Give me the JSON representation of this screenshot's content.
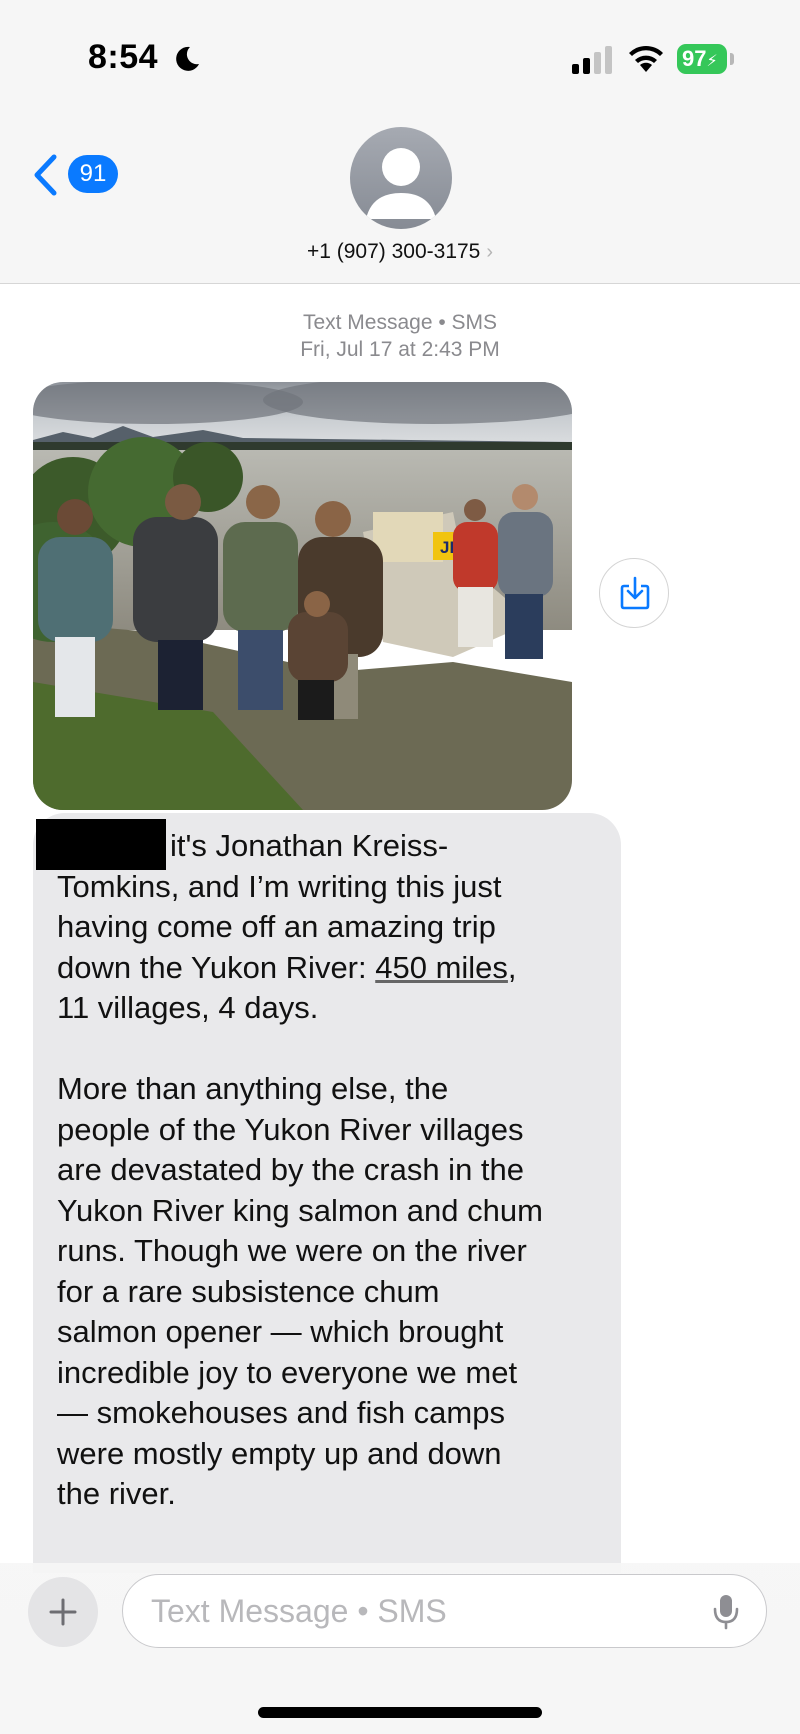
{
  "status_bar": {
    "time": "8:54",
    "battery": "97",
    "battery_color": "#35c759",
    "icons": [
      "moon-icon",
      "signal-icon",
      "wifi-icon",
      "battery-icon"
    ]
  },
  "header": {
    "back_badge": "91",
    "contact": "+1 (907) 300-3175",
    "contact_chevron": "›",
    "accent_color": "#0a7aff"
  },
  "conversation": {
    "service": "Text Message • SMS",
    "timestamp": "Fri, Jul 17 at 2:43 PM"
  },
  "message": {
    "line1_suffix": "it's Jonathan Kreiss-",
    "line2": "Tomkins, and I’m writing this just",
    "line3": "having come off an amazing trip",
    "line4_prefix": "down the Yukon River: ",
    "link": "450 miles",
    "line4_suffix": ",",
    "line5": "11 villages, 4 days.",
    "paragraph2": "More than anything else, the\npeople of the Yukon River villages\nare devastated by the crash in the\nYukon River king salmon and chum\nruns. Though we were on the river\nfor a rare subsistence chum\nsalmon opener — which brought\nincredible joy to everyone we met\n— smokehouses and fish camps\nwere mostly empty up and down\nthe river.",
    "bubble_color": "#e9e9eb"
  },
  "photo": {
    "sign_text": "JKT",
    "sign_color": "#f1c40f"
  },
  "compose": {
    "placeholder": "Text Message • SMS"
  }
}
